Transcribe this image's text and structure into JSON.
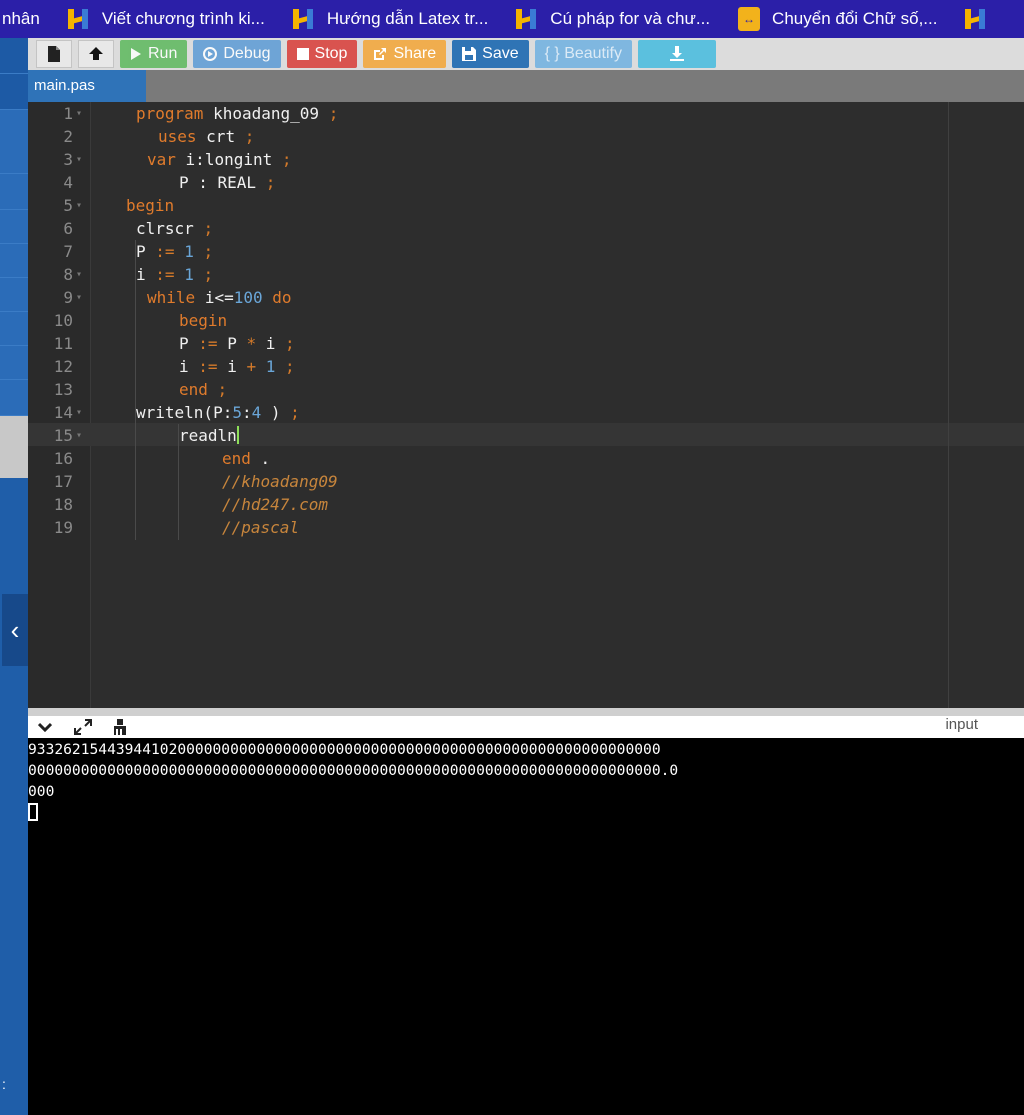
{
  "bookmarks": [
    {
      "label": "nhân",
      "icon": "none"
    },
    {
      "label": "Viết chương trình ki...",
      "icon": "hd-logo-icon"
    },
    {
      "label": "Hướng dẫn Latex tr...",
      "icon": "hd-logo-icon"
    },
    {
      "label": "Cú pháp for và chư...",
      "icon": "hd-logo-icon"
    },
    {
      "label": "Chuyển đổi Chữ số,...",
      "icon": "convert-icon"
    }
  ],
  "toolbar": {
    "run": "Run",
    "debug": "Debug",
    "stop": "Stop",
    "share": "Share",
    "save": "Save",
    "beautify": "{ } Beautify"
  },
  "file_tab": "main.pas",
  "code_lines": [
    {
      "n": "1",
      "fold": true
    },
    {
      "n": "2",
      "fold": false
    },
    {
      "n": "3",
      "fold": true
    },
    {
      "n": "4",
      "fold": false
    },
    {
      "n": "5",
      "fold": true
    },
    {
      "n": "6",
      "fold": false
    },
    {
      "n": "7",
      "fold": false
    },
    {
      "n": "8",
      "fold": true
    },
    {
      "n": "9",
      "fold": true
    },
    {
      "n": "10",
      "fold": false
    },
    {
      "n": "11",
      "fold": false
    },
    {
      "n": "12",
      "fold": false
    },
    {
      "n": "13",
      "fold": false
    },
    {
      "n": "14",
      "fold": true
    },
    {
      "n": "15",
      "fold": true
    },
    {
      "n": "16",
      "fold": false
    },
    {
      "n": "17",
      "fold": false
    },
    {
      "n": "18",
      "fold": false
    },
    {
      "n": "19",
      "fold": false
    }
  ],
  "code": {
    "l1": [
      "program",
      "khoadang_09",
      ";"
    ],
    "l2": [
      "uses",
      "crt",
      ";"
    ],
    "l3": [
      "var",
      "i:longint",
      ";"
    ],
    "l4": [
      "P : REAL",
      ";"
    ],
    "l5": [
      "begin"
    ],
    "l6": [
      "clrscr",
      ";"
    ],
    "l7": [
      "P",
      ":=",
      "1",
      ";"
    ],
    "l8": [
      "i",
      ":=",
      "1",
      ";"
    ],
    "l9": [
      "while",
      "i<=",
      "100",
      "do"
    ],
    "l10": [
      "begin"
    ],
    "l11": [
      "P",
      ":=",
      "P",
      "*",
      "i",
      ";"
    ],
    "l12": [
      "i",
      ":=",
      "i",
      "+",
      "1",
      ";"
    ],
    "l13": [
      "end",
      ";"
    ],
    "l14": [
      "writeln(P:",
      "5",
      ":",
      "4",
      ")",
      ";"
    ],
    "l15": [
      "readln"
    ],
    "l16": [
      "end",
      "."
    ],
    "l17": [
      "//khoadang09"
    ],
    "l18": [
      "//hd247.com"
    ],
    "l19": [
      "//pascal"
    ]
  },
  "console": {
    "tab_label": "input",
    "lines": [
      "933262154439441020000000000000000000000000000000000000000000000000000000",
      "000000000000000000000000000000000000000000000000000000000000000000000000.0",
      "000"
    ]
  }
}
